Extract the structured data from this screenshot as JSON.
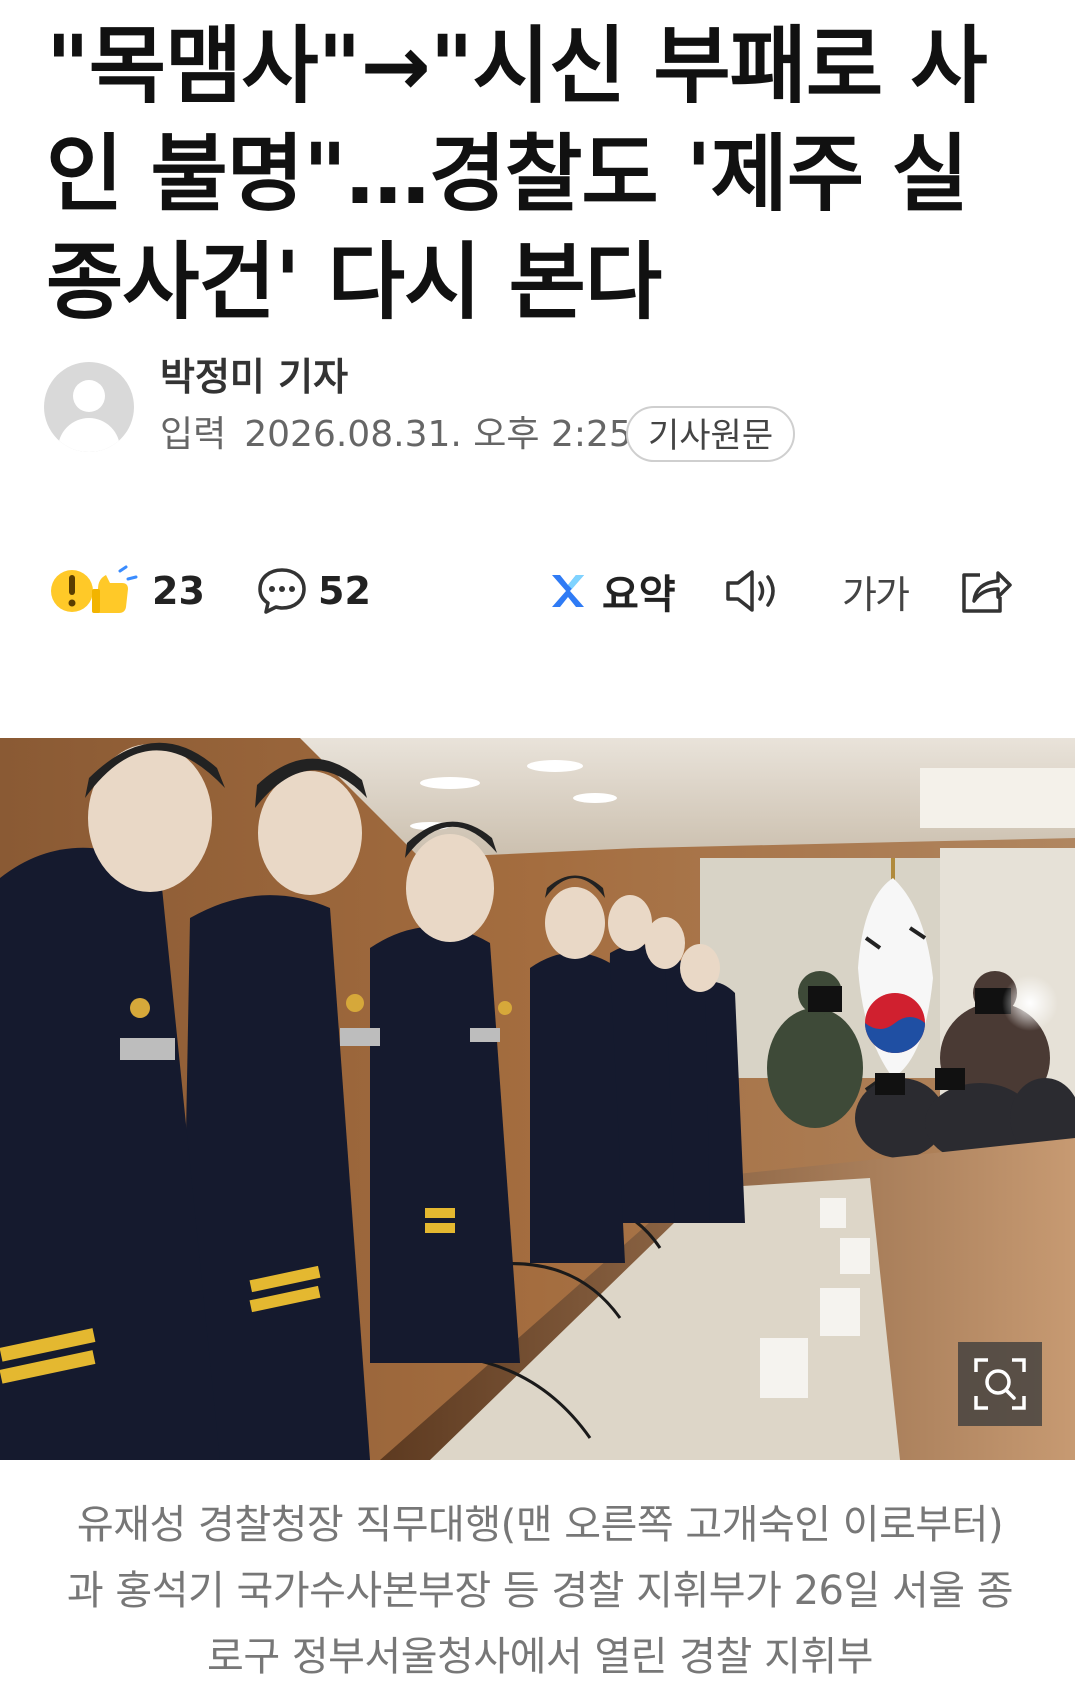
{
  "article": {
    "title": "\"목맴사\"→\"시신 부패로 사인 불명\"…경찰도 '제주 실종사건' 다시 본다",
    "reporter": "박정미 기자",
    "date_label": "입력",
    "date": "2026.08.31. 오후 2:25",
    "original_button": "기사원문"
  },
  "actions": {
    "reactions_count": "23",
    "comments_count": "52",
    "summary_label": "요약",
    "font_size_glyph": "가가"
  },
  "photo": {
    "caption": "유재성 경찰청장 직무대행(맨 오른쪽 고개숙인 이로부터)과 홍석기 국가수사본부장 등 경찰 지휘부가 26일 서울 종로구 정부서울청사에서 열린 경찰 지휘부"
  },
  "icons": {
    "reaction": "reaction-emoji-icon",
    "comment": "comment-bubble-icon",
    "summary": "ai-summary-icon",
    "tts": "speaker-icon",
    "share": "share-icon",
    "zoom": "zoom-search-icon"
  },
  "colors": {
    "summary_blue": "#2f7bf5",
    "reaction_yellow": "#ffc928",
    "caption_gray": "#777777",
    "uniform_navy": "#151a2e",
    "flag_red": "#d0202f",
    "flag_blue": "#1f4fa3"
  }
}
